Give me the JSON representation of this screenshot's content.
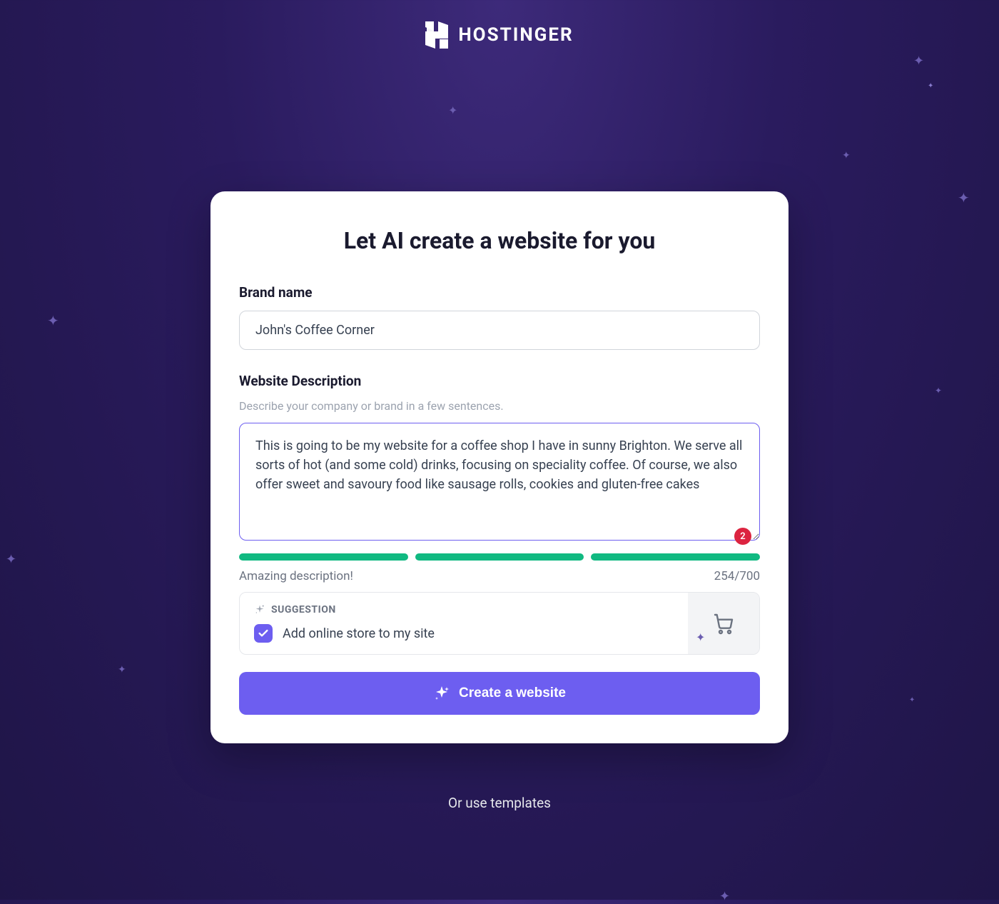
{
  "header": {
    "brand": "HOSTINGER"
  },
  "card": {
    "title": "Let AI create a website for you",
    "brand_name": {
      "label": "Brand name",
      "value": "John's Coffee Corner"
    },
    "description": {
      "label": "Website Description",
      "helper": "Describe your company or brand in a few sentences.",
      "value": "This is going to be my website for a coffee shop I have in sunny Brighton. We serve all sorts of hot (and some cold) drinks, focusing on speciality coffee. Of course, we also offer sweet and savoury food like sausage rolls, cookies and gluten-free cakes",
      "error_count": "2",
      "quality_text": "Amazing description!",
      "char_count": "254/700"
    },
    "suggestion": {
      "header": "SUGGESTION",
      "option_text": "Add online store to my site",
      "checked": true
    },
    "cta": "Create a website"
  },
  "footer": {
    "link": "Or use templates"
  }
}
